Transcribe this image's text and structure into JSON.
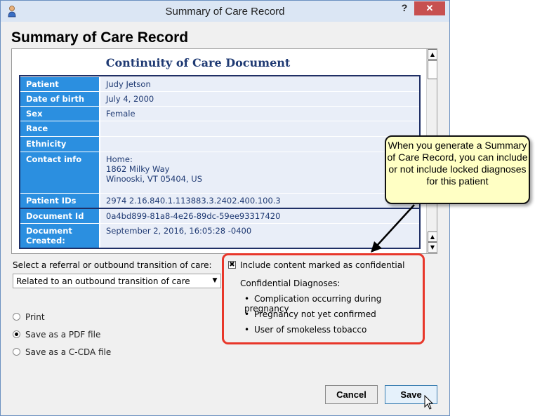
{
  "window": {
    "title": "Summary of Care Record",
    "help_label": "?",
    "close_label": "✕",
    "heading": "Summary of Care Record"
  },
  "document": {
    "title": "Continuity of Care Document",
    "rows": [
      {
        "label": "Patient",
        "value": "Judy Jetson"
      },
      {
        "label": "Date of birth",
        "value": "July 4, 2000"
      },
      {
        "label": "Sex",
        "value": "Female"
      },
      {
        "label": "Race",
        "value": ""
      },
      {
        "label": "Ethnicity",
        "value": ""
      },
      {
        "label": "Contact info",
        "value": "Home:\n1862 Milky Way\nWinooski, VT 05404, US"
      },
      {
        "label": "Patient IDs",
        "value": "2974 2.16.840.1.113883.3.2402.400.100.3"
      },
      {
        "label": "Document Id",
        "value": "0a4bd899-81a8-4e26-89dc-59ee93317420"
      },
      {
        "label": "Document Created:",
        "value": "September 2, 2016, 16:05:28 -0400"
      }
    ]
  },
  "referral": {
    "label": "Select a referral or outbound transition of care:",
    "selected": "Related to an outbound transition of care"
  },
  "output_options": [
    {
      "label": "Print",
      "selected": false
    },
    {
      "label": "Save as a PDF file",
      "selected": true
    },
    {
      "label": "Save as a C-CDA file",
      "selected": false
    }
  ],
  "confidential": {
    "checkbox_label": "Include content marked as confidential",
    "checked": true,
    "heading": "Confidential Diagnoses:",
    "diagnoses": [
      "Complication occurring during pregnancy",
      "Pregnancy not yet confirmed",
      "User of smokeless tobacco"
    ]
  },
  "callout": {
    "text": "When you generate a Summary of Care Record, you can include or not include locked diagnoses for this patient"
  },
  "buttons": {
    "cancel": "Cancel",
    "save": "Save"
  },
  "colors": {
    "label_bg": "#2b8fe0",
    "value_bg": "#e9eef8",
    "table_border": "#1f2f66",
    "highlight_border": "#e8372a",
    "callout_bg": "#ffffc4",
    "close_button": "#c75050"
  }
}
